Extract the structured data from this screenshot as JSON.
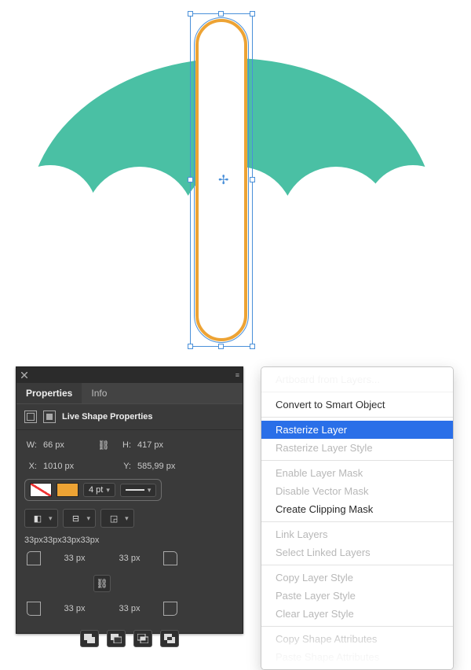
{
  "canvas": {
    "shape_fill": "none",
    "shape_stroke": "#eda334"
  },
  "panel": {
    "tabs": {
      "properties": "Properties",
      "info": "Info"
    },
    "section_title": "Live Shape Properties",
    "w_label": "W:",
    "h_label": "H:",
    "x_label": "X:",
    "y_label": "Y:",
    "w_value": "66 px",
    "h_value": "417 px",
    "x_value": "1010 px",
    "y_value": "585,99 px",
    "stroke_weight": "4 pt",
    "radius_string": "33px33px33px33px",
    "corner_tl": "33 px",
    "corner_tr": "33 px",
    "corner_bl": "33 px",
    "corner_br": "33 px"
  },
  "menu": {
    "artboard_from_layers": "Artboard from Layers...",
    "convert_smart": "Convert to Smart Object",
    "rasterize_layer": "Rasterize Layer",
    "rasterize_style": "Rasterize Layer Style",
    "enable_mask": "Enable Layer Mask",
    "disable_vmask": "Disable Vector Mask",
    "create_clip": "Create Clipping Mask",
    "link_layers": "Link Layers",
    "select_linked": "Select Linked Layers",
    "copy_style": "Copy Layer Style",
    "paste_style": "Paste Layer Style",
    "clear_style": "Clear Layer Style",
    "copy_shape_attr": "Copy Shape Attributes",
    "paste_shape_attr": "Paste Shape Attributes"
  }
}
